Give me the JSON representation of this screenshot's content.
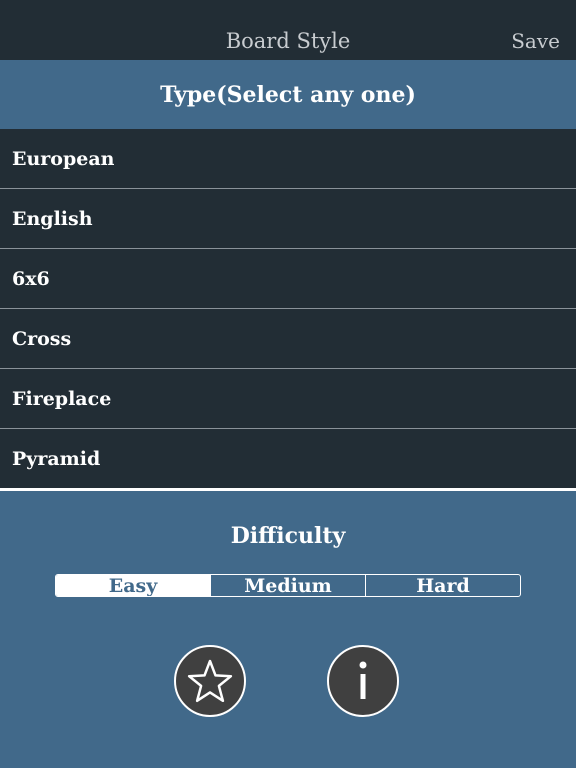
{
  "navbar": {
    "title": "Board Style",
    "save_label": "Save"
  },
  "type_section": {
    "header": "Type(Select any one)",
    "items": [
      {
        "label": "European"
      },
      {
        "label": "English"
      },
      {
        "label": "6x6"
      },
      {
        "label": "Cross"
      },
      {
        "label": "Fireplace"
      },
      {
        "label": "Pyramid"
      }
    ]
  },
  "difficulty": {
    "label": "Difficulty",
    "options": [
      "Easy",
      "Medium",
      "Hard"
    ],
    "selected": "Easy"
  },
  "actions": {
    "star_icon": "star-icon",
    "info_icon": "info-icon"
  },
  "colors": {
    "navbar_bg": "#222d35",
    "accent_blue": "#41698a",
    "list_bg": "#222d35",
    "button_bg": "#404040"
  }
}
